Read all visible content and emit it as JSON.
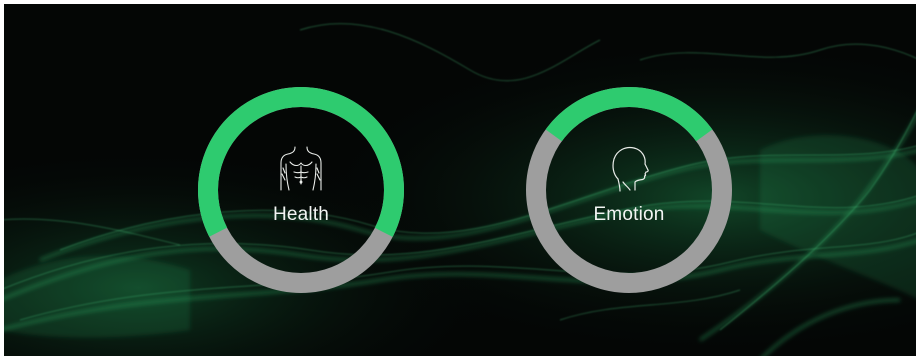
{
  "colors": {
    "background": "#040605",
    "smoke": "#1f8a4c",
    "ring_fill": "#2ecb6f",
    "ring_track": "#9e9e9e",
    "text": "#f2f5f3"
  },
  "gauges": [
    {
      "label": "Health",
      "icon": "torso-icon",
      "fill_fraction": 0.65
    },
    {
      "label": "Emotion",
      "icon": "head-profile-icon",
      "fill_fraction": 0.3
    }
  ]
}
